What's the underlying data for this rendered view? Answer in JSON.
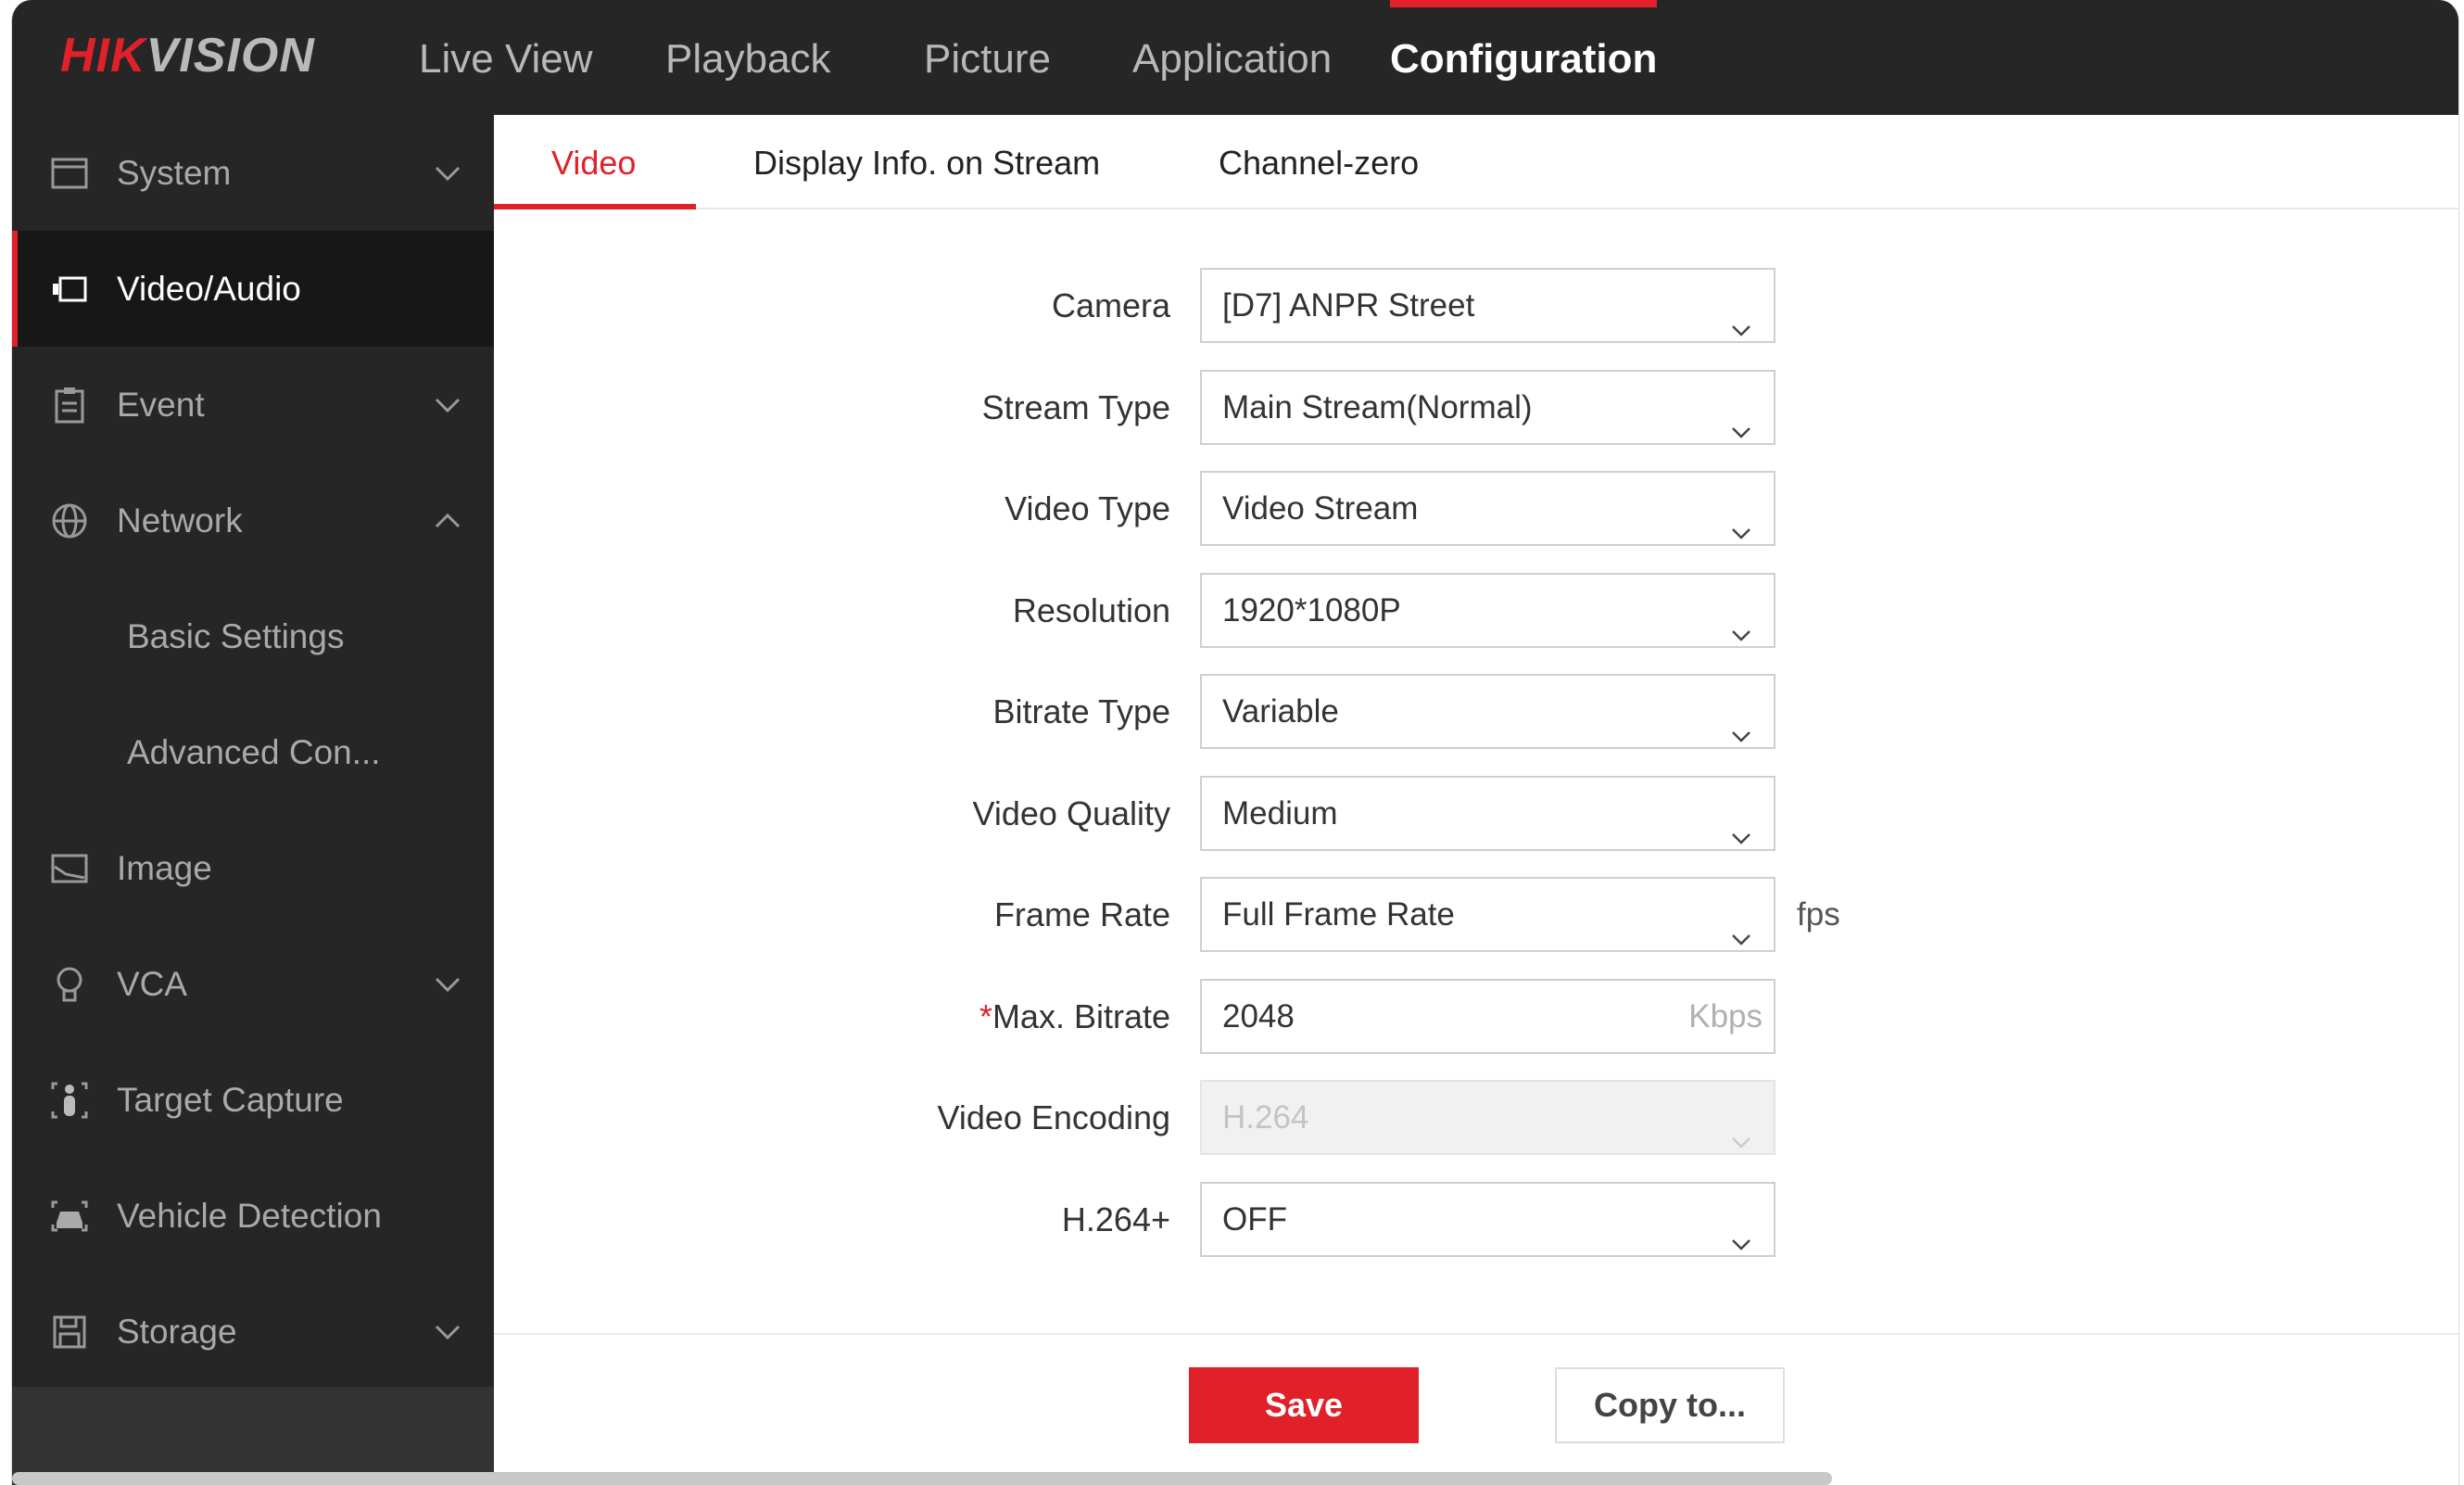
{
  "header": {
    "logo": "HIKVISION",
    "logo_red": "HIK",
    "logo_gray": "VISION",
    "nav": [
      {
        "label": "Live View"
      },
      {
        "label": "Playback"
      },
      {
        "label": "Picture"
      },
      {
        "label": "Application"
      },
      {
        "label": "Configuration",
        "active": true
      }
    ]
  },
  "sidebar": {
    "items": [
      {
        "label": "System",
        "icon": "system-icon",
        "chevron": "down"
      },
      {
        "label": "Video/Audio",
        "icon": "video-audio-icon",
        "active": true
      },
      {
        "label": "Event",
        "icon": "event-icon",
        "chevron": "down"
      },
      {
        "label": "Network",
        "icon": "network-icon",
        "chevron": "up"
      },
      {
        "label": "Basic Settings",
        "sub": true
      },
      {
        "label": "Advanced Con...",
        "sub": true
      },
      {
        "label": "Image",
        "icon": "image-icon"
      },
      {
        "label": "VCA",
        "icon": "vca-icon",
        "chevron": "down"
      },
      {
        "label": "Target Capture",
        "icon": "target-capture-icon"
      },
      {
        "label": "Vehicle Detection",
        "icon": "vehicle-detection-icon"
      },
      {
        "label": "Storage",
        "icon": "storage-icon",
        "chevron": "down"
      }
    ]
  },
  "tabs": [
    {
      "label": "Video",
      "active": true
    },
    {
      "label": "Display Info. on Stream"
    },
    {
      "label": "Channel-zero"
    }
  ],
  "form": {
    "camera": {
      "label": "Camera",
      "value": "[D7] ANPR Street"
    },
    "stream_type": {
      "label": "Stream Type",
      "value": "Main Stream(Normal)"
    },
    "video_type": {
      "label": "Video Type",
      "value": "Video Stream"
    },
    "resolution": {
      "label": "Resolution",
      "value": "1920*1080P"
    },
    "bitrate_type": {
      "label": "Bitrate Type",
      "value": "Variable"
    },
    "video_quality": {
      "label": "Video Quality",
      "value": "Medium"
    },
    "frame_rate": {
      "label": "Frame Rate",
      "value": "Full Frame Rate",
      "unit": "fps"
    },
    "max_bitrate": {
      "required": "*",
      "label": "Max. Bitrate",
      "value": "2048",
      "unit": "Kbps"
    },
    "video_encoding": {
      "label": "Video Encoding",
      "value": "H.264",
      "disabled": true
    },
    "h264plus": {
      "label": "H.264+",
      "value": "OFF"
    }
  },
  "buttons": {
    "save": "Save",
    "copy": "Copy to..."
  },
  "colors": {
    "accent": "#e0212a",
    "header": "#262626",
    "sidebar_active": "#171717"
  }
}
